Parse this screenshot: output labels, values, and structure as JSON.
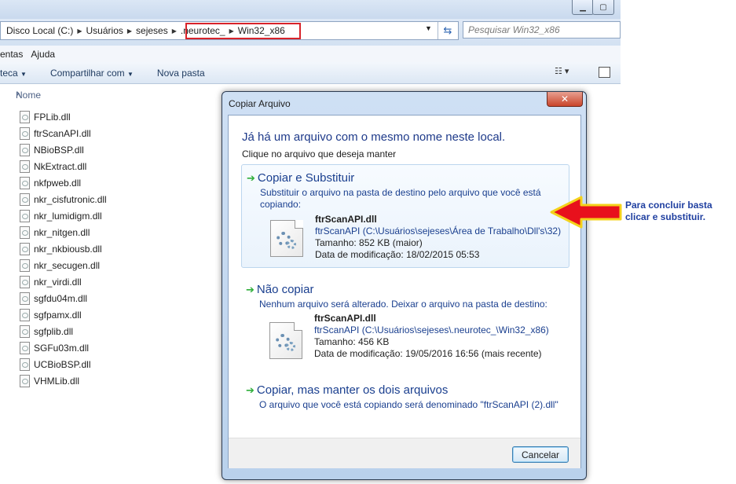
{
  "address": {
    "crumbs": [
      "Disco Local (C:)",
      "Usuários",
      "sejeses",
      ".neurotec_",
      "Win32_x86"
    ],
    "search_placeholder": "Pesquisar Win32_x86"
  },
  "menu": [
    "entas",
    "Ajuda"
  ],
  "toolbar": {
    "library": "teca",
    "share": "Compartilhar com",
    "new_folder": "Nova pasta"
  },
  "file_list": {
    "column_name": "Nome",
    "files": [
      "FPLib.dll",
      "ftrScanAPI.dll",
      "NBioBSP.dll",
      "NkExtract.dll",
      "nkfpweb.dll",
      "nkr_cisfutronic.dll",
      "nkr_lumidigm.dll",
      "nkr_nitgen.dll",
      "nkr_nkbiousb.dll",
      "nkr_secugen.dll",
      "nkr_virdi.dll",
      "sgfdu04m.dll",
      "sgfpamx.dll",
      "sgfplib.dll",
      "SGFu03m.dll",
      "UCBioBSP.dll",
      "VHMLib.dll"
    ]
  },
  "dialog": {
    "title": "Copiar Arquivo",
    "heading": "Já há um arquivo com o mesmo nome neste local.",
    "subheading": "Clique no arquivo que deseja manter",
    "option_replace": {
      "title": "Copiar e Substituir",
      "desc": "Substituir o arquivo na pasta de destino pelo arquivo que você está copiando:",
      "file_name": "ftrScanAPI.dll",
      "file_path": "ftrScanAPI (C:\\Usuários\\sejeses\\Área de Trabalho\\Dll's\\32)",
      "size": "Tamanho: 852 KB (maior)",
      "modified": "Data de modificação: 18/02/2015 05:53"
    },
    "option_skip": {
      "title": "Não copiar",
      "desc": "Nenhum arquivo será alterado. Deixar o arquivo na pasta de destino:",
      "file_name": "ftrScanAPI.dll",
      "file_path": "ftrScanAPI (C:\\Usuários\\sejeses\\.neurotec_\\Win32_x86)",
      "size": "Tamanho: 456 KB",
      "modified": "Data de modificação: 19/05/2016 16:56 (mais recente)"
    },
    "option_keep_both": {
      "title": "Copiar, mas manter os dois arquivos",
      "desc": "O arquivo que você está copiando será denominado \"ftrScanAPI (2).dll\""
    },
    "cancel_label": "Cancelar",
    "close_glyph": "✕"
  },
  "annotation": {
    "line1": "Para concluir basta",
    "line2": "clicar e substituir."
  },
  "colors": {
    "highlight_box": "#d8232a",
    "arrow_fill": "#e8101c",
    "arrow_outline": "#f4d21a",
    "annotation_text": "#1f3fa0"
  }
}
